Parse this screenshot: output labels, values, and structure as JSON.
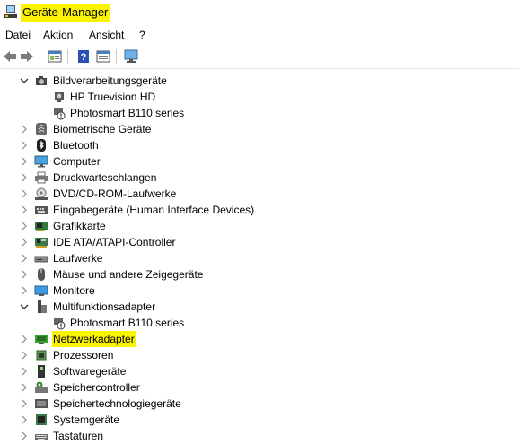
{
  "window": {
    "title": "Geräte-Manager"
  },
  "menu": {
    "items": [
      "Datei",
      "Aktion",
      "Ansicht",
      "?"
    ]
  },
  "toolbar": {
    "buttons": [
      "back-icon",
      "forward-icon",
      "properties-icon",
      "help-icon",
      "view-icon",
      "monitor-scan-icon"
    ]
  },
  "tree": {
    "root_expanded_label": "Bildverarbeitungsgeräte",
    "imaging_children": [
      "HP Truevision HD",
      "Photosmart B110 series"
    ],
    "categories": [
      "Biometrische Geräte",
      "Bluetooth",
      "Computer",
      "Druckwarteschlangen",
      "DVD/CD-ROM-Laufwerke",
      "Eingabegeräte (Human Interface Devices)",
      "Grafikkarte",
      "IDE ATA/ATAPI-Controller",
      "Laufwerke",
      "Mäuse und andere Zeigegeräte",
      "Monitore"
    ],
    "multifunction_label": "Multifunktionsadapter",
    "multifunction_children": [
      "Photosmart B110 series"
    ],
    "after": [
      "Netzwerkadapter",
      "Prozessoren",
      "Softwaregeräte",
      "Speichercontroller",
      "Speichertechnologiegeräte",
      "Systemgeräte",
      "Tastaturen"
    ]
  },
  "colors": {
    "highlight": "#f9f200"
  }
}
